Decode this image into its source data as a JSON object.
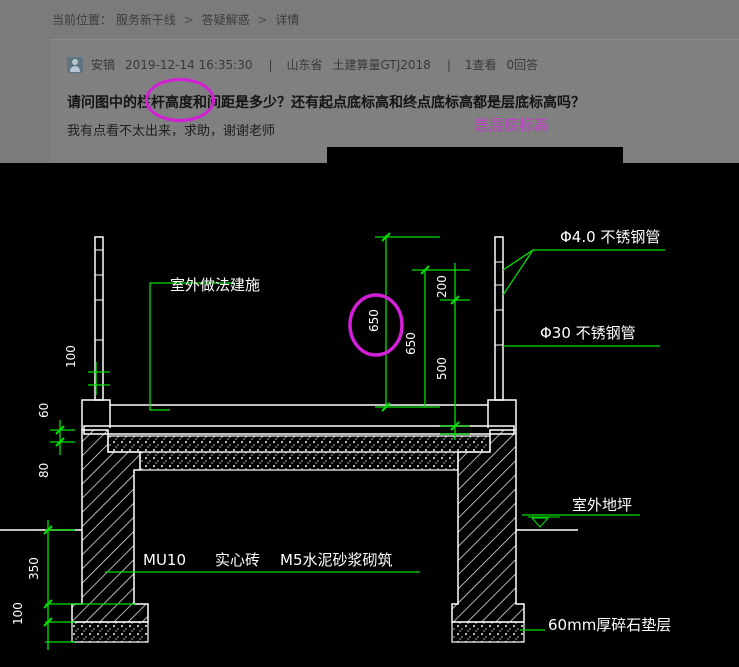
{
  "breadcrumb": {
    "prefix": "当前位置：",
    "items": [
      "服务新干线",
      "答疑解惑",
      "详情"
    ],
    "separator": ">"
  },
  "post": {
    "author": "安镝",
    "datetime": "2019-12-14 16:35:30",
    "region": "山东省",
    "software": "土建算量GTJ2018",
    "stats": "1查看",
    "answers": "0回答",
    "meta_separator": "|",
    "question": "请问图中的栏杆高度和间距是多少？还有起点底标高和终点底标高都是层底标高吗？",
    "detail": "我有点看不太出来，求助，谢谢老师"
  },
  "annotation_note": "是层底标高",
  "drawing": {
    "labels": {
      "steel_top": "Φ4.0  不锈钢管",
      "steel_mid": "Φ30  不锈钢管",
      "inner_finish": "室外做法建施",
      "outer_ground": "室外地坪",
      "wall_note_a": "MU10",
      "wall_note_b": "实心砖",
      "wall_note_c": "M5水泥砂浆砌筑",
      "base_note": "60mm厚碎石垫层"
    },
    "dims": {
      "total": "650",
      "upper": "200",
      "lower": "500",
      "d100": "100",
      "d60": "60",
      "d80": "80",
      "d350": "350",
      "d100b": "100"
    }
  },
  "colors": {
    "cad_green": "#00e000",
    "cad_white": "#ffffff",
    "highlight": "#d41ed8"
  }
}
